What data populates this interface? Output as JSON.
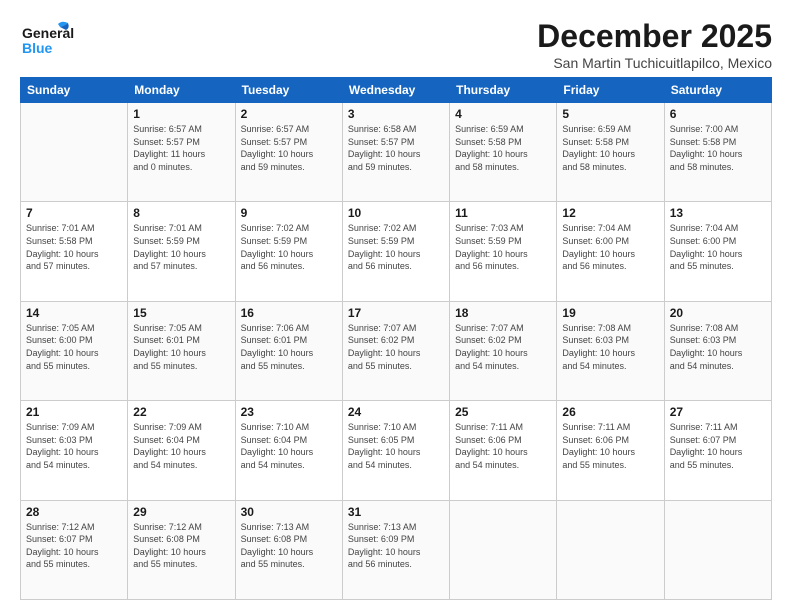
{
  "logo": {
    "line1": "General",
    "line2": "Blue"
  },
  "title": "December 2025",
  "subtitle": "San Martin Tuchicuitlapilco, Mexico",
  "days_of_week": [
    "Sunday",
    "Monday",
    "Tuesday",
    "Wednesday",
    "Thursday",
    "Friday",
    "Saturday"
  ],
  "weeks": [
    [
      {
        "day": "",
        "info": ""
      },
      {
        "day": "1",
        "info": "Sunrise: 6:57 AM\nSunset: 5:57 PM\nDaylight: 11 hours\nand 0 minutes."
      },
      {
        "day": "2",
        "info": "Sunrise: 6:57 AM\nSunset: 5:57 PM\nDaylight: 10 hours\nand 59 minutes."
      },
      {
        "day": "3",
        "info": "Sunrise: 6:58 AM\nSunset: 5:57 PM\nDaylight: 10 hours\nand 59 minutes."
      },
      {
        "day": "4",
        "info": "Sunrise: 6:59 AM\nSunset: 5:58 PM\nDaylight: 10 hours\nand 58 minutes."
      },
      {
        "day": "5",
        "info": "Sunrise: 6:59 AM\nSunset: 5:58 PM\nDaylight: 10 hours\nand 58 minutes."
      },
      {
        "day": "6",
        "info": "Sunrise: 7:00 AM\nSunset: 5:58 PM\nDaylight: 10 hours\nand 58 minutes."
      }
    ],
    [
      {
        "day": "7",
        "info": "Sunrise: 7:01 AM\nSunset: 5:58 PM\nDaylight: 10 hours\nand 57 minutes."
      },
      {
        "day": "8",
        "info": "Sunrise: 7:01 AM\nSunset: 5:59 PM\nDaylight: 10 hours\nand 57 minutes."
      },
      {
        "day": "9",
        "info": "Sunrise: 7:02 AM\nSunset: 5:59 PM\nDaylight: 10 hours\nand 56 minutes."
      },
      {
        "day": "10",
        "info": "Sunrise: 7:02 AM\nSunset: 5:59 PM\nDaylight: 10 hours\nand 56 minutes."
      },
      {
        "day": "11",
        "info": "Sunrise: 7:03 AM\nSunset: 5:59 PM\nDaylight: 10 hours\nand 56 minutes."
      },
      {
        "day": "12",
        "info": "Sunrise: 7:04 AM\nSunset: 6:00 PM\nDaylight: 10 hours\nand 56 minutes."
      },
      {
        "day": "13",
        "info": "Sunrise: 7:04 AM\nSunset: 6:00 PM\nDaylight: 10 hours\nand 55 minutes."
      }
    ],
    [
      {
        "day": "14",
        "info": "Sunrise: 7:05 AM\nSunset: 6:00 PM\nDaylight: 10 hours\nand 55 minutes."
      },
      {
        "day": "15",
        "info": "Sunrise: 7:05 AM\nSunset: 6:01 PM\nDaylight: 10 hours\nand 55 minutes."
      },
      {
        "day": "16",
        "info": "Sunrise: 7:06 AM\nSunset: 6:01 PM\nDaylight: 10 hours\nand 55 minutes."
      },
      {
        "day": "17",
        "info": "Sunrise: 7:07 AM\nSunset: 6:02 PM\nDaylight: 10 hours\nand 55 minutes."
      },
      {
        "day": "18",
        "info": "Sunrise: 7:07 AM\nSunset: 6:02 PM\nDaylight: 10 hours\nand 54 minutes."
      },
      {
        "day": "19",
        "info": "Sunrise: 7:08 AM\nSunset: 6:03 PM\nDaylight: 10 hours\nand 54 minutes."
      },
      {
        "day": "20",
        "info": "Sunrise: 7:08 AM\nSunset: 6:03 PM\nDaylight: 10 hours\nand 54 minutes."
      }
    ],
    [
      {
        "day": "21",
        "info": "Sunrise: 7:09 AM\nSunset: 6:03 PM\nDaylight: 10 hours\nand 54 minutes."
      },
      {
        "day": "22",
        "info": "Sunrise: 7:09 AM\nSunset: 6:04 PM\nDaylight: 10 hours\nand 54 minutes."
      },
      {
        "day": "23",
        "info": "Sunrise: 7:10 AM\nSunset: 6:04 PM\nDaylight: 10 hours\nand 54 minutes."
      },
      {
        "day": "24",
        "info": "Sunrise: 7:10 AM\nSunset: 6:05 PM\nDaylight: 10 hours\nand 54 minutes."
      },
      {
        "day": "25",
        "info": "Sunrise: 7:11 AM\nSunset: 6:06 PM\nDaylight: 10 hours\nand 54 minutes."
      },
      {
        "day": "26",
        "info": "Sunrise: 7:11 AM\nSunset: 6:06 PM\nDaylight: 10 hours\nand 55 minutes."
      },
      {
        "day": "27",
        "info": "Sunrise: 7:11 AM\nSunset: 6:07 PM\nDaylight: 10 hours\nand 55 minutes."
      }
    ],
    [
      {
        "day": "28",
        "info": "Sunrise: 7:12 AM\nSunset: 6:07 PM\nDaylight: 10 hours\nand 55 minutes."
      },
      {
        "day": "29",
        "info": "Sunrise: 7:12 AM\nSunset: 6:08 PM\nDaylight: 10 hours\nand 55 minutes."
      },
      {
        "day": "30",
        "info": "Sunrise: 7:13 AM\nSunset: 6:08 PM\nDaylight: 10 hours\nand 55 minutes."
      },
      {
        "day": "31",
        "info": "Sunrise: 7:13 AM\nSunset: 6:09 PM\nDaylight: 10 hours\nand 56 minutes."
      },
      {
        "day": "",
        "info": ""
      },
      {
        "day": "",
        "info": ""
      },
      {
        "day": "",
        "info": ""
      }
    ]
  ]
}
